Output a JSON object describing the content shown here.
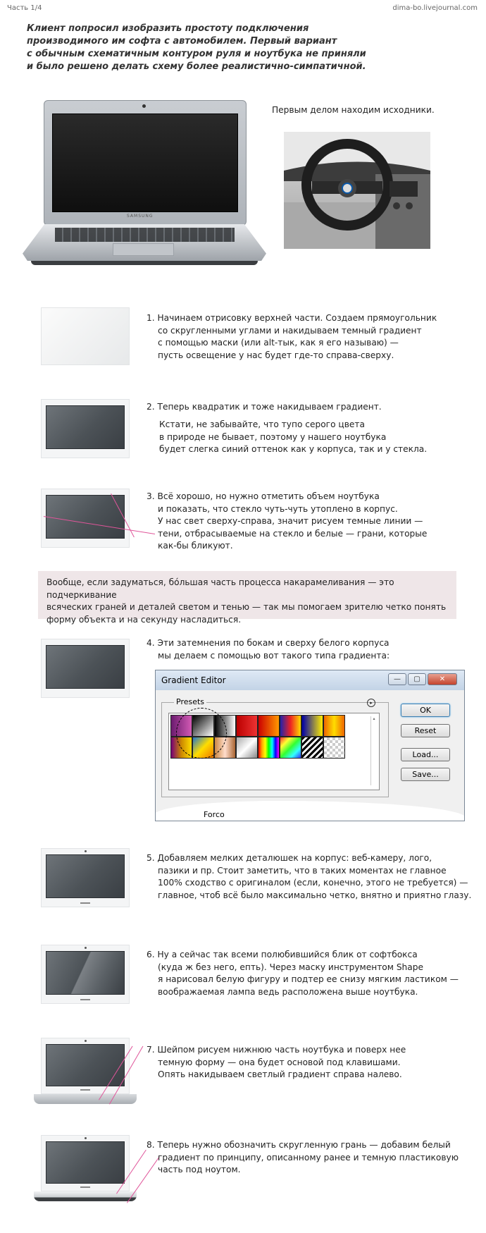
{
  "header": {
    "part": "Часть 1/4",
    "source": "dima-bo.livejournal.com"
  },
  "intro": [
    "Клиент попросил изобразить простоту подключения",
    "производимого им софта с автомобилем. Первый вариант",
    "с обычным схематичным контуром руля и ноутбука не приняли",
    "и было решено делать схему более реалистично-симпатичной."
  ],
  "sources_caption": "Первым делом находим исходники.",
  "laptop_brand": "SAMSUNG",
  "steps": {
    "s1": [
      "1. Начинаем отрисовку верхней части. Создаем прямоугольник",
      "со скругленными углами и накидываем темный градиент",
      "с помощью маски (или alt-тык, как я его называю) —",
      "пусть освещение у нас будет где-то справа-сверху."
    ],
    "s2": [
      "2. Теперь квадратик и тоже накидываем градиент."
    ],
    "s2b": [
      "Кстати, не забывайте, что тупо серого цвета",
      "в природе не бывает, поэтому у нашего ноутбука",
      "будет слегка синий оттенок как у корпуса, так и у стекла."
    ],
    "s3": [
      "3. Всё хорошо, но нужно отметить объем ноутбука",
      "и показать, что стекло чуть-чуть утоплено в корпус.",
      "У нас свет сверху-справа, значит рисуем темные линии —",
      "тени, отбрасываемые на стекло и белые — грани, которые",
      "как-бы бликуют."
    ],
    "s4": [
      "4. Эти затемнения по бокам и сверху белого корпуса",
      "мы делаем с помощью вот такого типа градиента:"
    ],
    "s5": [
      "5. Добавляем мелких деталюшек на корпус: веб-камеру, лого,",
      "пазики и пр. Стоит заметить, что в таких моментах не главное",
      "100% сходство с оригиналом (если, конечно, этого не требуется) —",
      "главное, чтоб всё было максимально четко, внятно и приятно глазу."
    ],
    "s6": [
      "6. Ну а сейчас так всеми полюбившийся блик от софтбокса",
      "(куда ж без него, епть). Через маску инструментом Shape",
      "я нарисовал белую фигуру и подтер ее снизу мягким ластиком —",
      "воображаемая лампа ведь расположена выше ноутбука."
    ],
    "s7": [
      "7. Шейпом рисуем нижнюю часть ноутбука и поверх нее",
      "темную форму — она будет основой под клавишами.",
      "Опять накидываем светлый градиент справа налево."
    ],
    "s8": [
      "8. Теперь нужно обозначить скругленную грань — добавим белый",
      "градиент по принципу, описанному ранее и темную пластиковую",
      "часть под ноутом."
    ]
  },
  "note": [
    "Вообще, если задуматься, бóльшая часть процесса накарамеливания — это подчеркивание",
    "всяческих граней и деталей светом и тенью — так мы помогаем зрителю четко понять",
    "форму объекта и на секунду насладиться."
  ],
  "gradient_editor": {
    "title": "Gradient Editor",
    "presets_label": "Presets",
    "buttons": [
      "OK",
      "Reset",
      "Load...",
      "Save..."
    ],
    "name_field_partial": "Forco"
  },
  "colors": {
    "accent_line": "#e0559a",
    "note_bg": "#efe6e8"
  }
}
